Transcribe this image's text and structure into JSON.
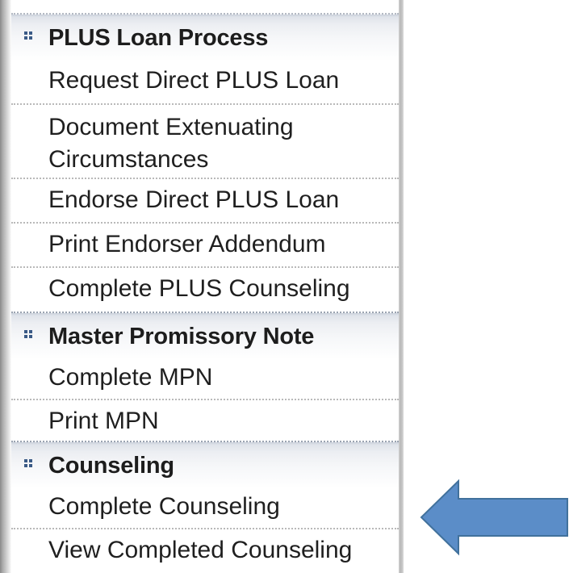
{
  "menu": {
    "sections": [
      {
        "title": "PLUS Loan Process",
        "items": [
          "Request Direct PLUS Loan",
          "Document Extenuating Circumstances",
          "Endorse Direct PLUS Loan",
          "Print Endorser Addendum",
          "Complete PLUS Counseling"
        ]
      },
      {
        "title": "Master Promissory Note",
        "items": [
          "Complete MPN",
          "Print MPN"
        ]
      },
      {
        "title": "Counseling",
        "items": [
          "Complete Counseling",
          "View Completed Counseling"
        ]
      }
    ]
  },
  "doc_extenuating": {
    "line1": "Document Extenuating",
    "line2": "Circumstances"
  },
  "colors": {
    "arrow_fill": "#5b8dc8",
    "arrow_stroke": "#41719c",
    "section_bullet": "#3a5a86"
  },
  "icons": {
    "section_bullet": "four-dot-bullet-icon",
    "annotation_arrow": "left-arrow-icon"
  }
}
